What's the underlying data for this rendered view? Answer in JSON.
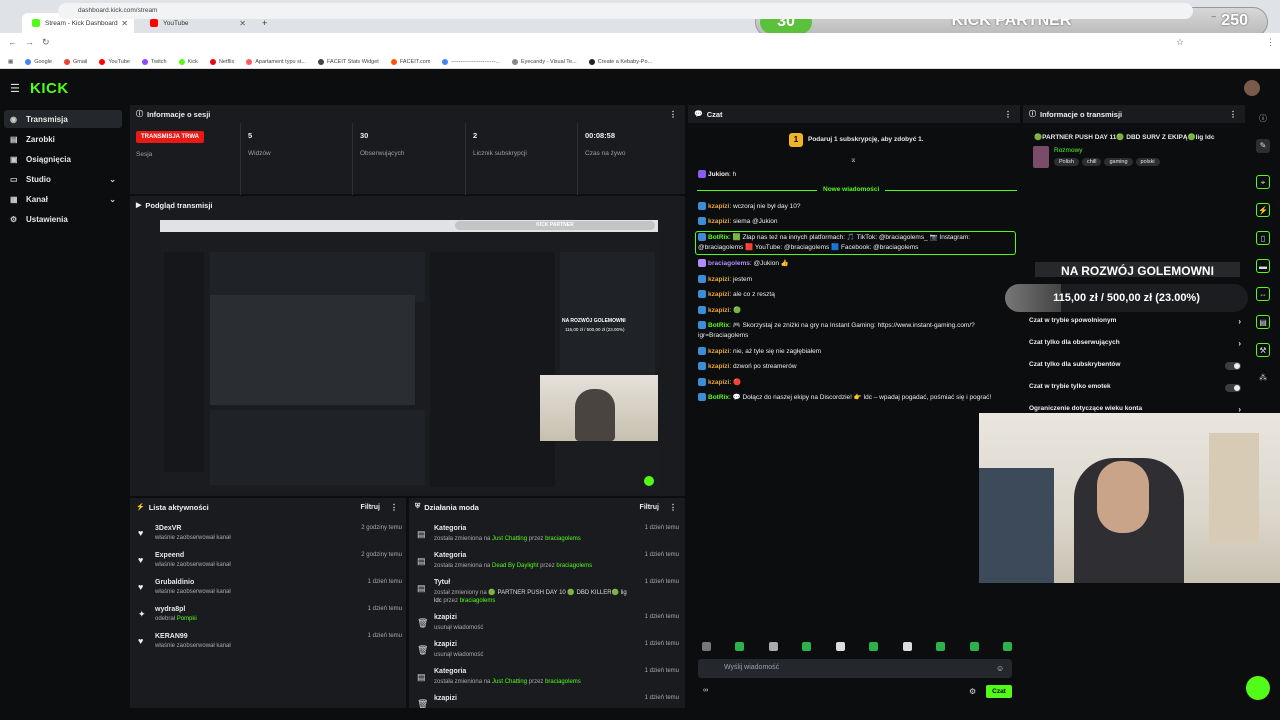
{
  "browser": {
    "tabs": [
      {
        "label": "Stream - Kick Dashboard",
        "active": true
      },
      {
        "label": "YouTube",
        "active": false
      }
    ],
    "new_tab": "+",
    "url": "dashboard.kick.com/stream",
    "bookmarks": [
      "Google",
      "Gmail",
      "YouTube",
      "Twitch",
      "Kick",
      "Netflix",
      "Apartament typu st...",
      "FACEIT Stats Widget",
      "FACEIT.com",
      "------------------------...",
      "Eyecandy - Visual Te...",
      "Create a Kebaby-Po..."
    ]
  },
  "overlay": {
    "level": "30",
    "title": "KICK PARTNER",
    "score": "250",
    "sep": "–"
  },
  "app": {
    "logo": "KICK"
  },
  "sidebar": {
    "items": [
      {
        "label": "Transmisja",
        "icon": "broadcast-icon"
      },
      {
        "label": "Zarobki",
        "icon": "wallet-icon"
      },
      {
        "label": "Osiągnięcia",
        "icon": "trophy-icon"
      },
      {
        "label": "Studio",
        "icon": "studio-icon"
      },
      {
        "label": "Kanał",
        "icon": "channel-icon"
      },
      {
        "label": "Ustawienia",
        "icon": "gear-icon"
      }
    ]
  },
  "session": {
    "title": "Informacje o sesji",
    "live_badge": "TRANSMISJA TRWA",
    "session_label": "Sesja",
    "stats": [
      {
        "value": "5",
        "label": "Widzów"
      },
      {
        "value": "30",
        "label": "Obserwujących"
      },
      {
        "value": "2",
        "label": "Licznik subskrypcji"
      },
      {
        "value": "00:08:58",
        "label": "Czas na żywo"
      }
    ]
  },
  "preview": {
    "title": "Podgląd transmisji",
    "inner_title": "KICK PARTNER",
    "inner_goal": "NA ROZWÓJ GOLEMOWNI",
    "inner_goal_sub": "115,00 zł / 500,00 zł (23.00%)"
  },
  "activity": {
    "title": "Lista aktywności",
    "filter": "Filtruj",
    "items": [
      {
        "name": "3DexVR",
        "sub": "właśnie zaobserwował kanał",
        "time": "2 godziny temu"
      },
      {
        "name": "Expeend",
        "sub": "właśnie zaobserwował kanał",
        "time": "2 godziny temu"
      },
      {
        "name": "Grubaldinio",
        "sub": "właśnie zaobserwował kanał",
        "time": "1 dzień temu"
      },
      {
        "name": "wydra8pl",
        "sub": "odebrał",
        "highlight": "Pompki",
        "time": "1 dzień temu"
      },
      {
        "name": "KERAN99",
        "sub": "właśnie zaobserwował kanał",
        "time": "1 dzień temu"
      }
    ]
  },
  "mod": {
    "title": "Działania moda",
    "filter": "Filtruj",
    "items": [
      {
        "name": "Kategoria",
        "pre": "została zmieniona na",
        "hl1": "Just Chatting",
        "mid": "przez",
        "hl2": "braciagolems",
        "time": "1 dzień temu"
      },
      {
        "name": "Kategoria",
        "pre": "została zmieniona na",
        "hl1": "Dead By Daylight",
        "mid": "przez",
        "hl2": "braciagolems",
        "time": "1 dzień temu"
      },
      {
        "name": "Tytuł",
        "pre": "został zmieniony na",
        "hl1": "🟢 PARTNER PUSH DAY 10 🟢 DBD KILLER🟢 lig ldc",
        "mid": "przez",
        "hl2": "braciagolems",
        "time": "1 dzień temu"
      },
      {
        "name": "kzapizi",
        "pre": "usunął wiadomość",
        "hl1": "",
        "mid": "",
        "hl2": "",
        "time": "1 dzień temu"
      },
      {
        "name": "kzapizi",
        "pre": "usunął wiadomość",
        "hl1": "",
        "mid": "",
        "hl2": "",
        "time": "1 dzień temu"
      },
      {
        "name": "Kategoria",
        "pre": "została zmieniona na",
        "hl1": "Just Chatting",
        "mid": "przez",
        "hl2": "braciagolems",
        "time": "1 dzień temu"
      },
      {
        "name": "kzapizi",
        "pre": "",
        "hl1": "",
        "mid": "",
        "hl2": "",
        "time": "1 dzień temu"
      }
    ]
  },
  "chat": {
    "title": "Czat",
    "sub_prompt": "Podaruj 1 subskrypcję, aby zdobyć 1.",
    "new_messages": "Nowe wiadomości",
    "messages": [
      {
        "user": "Jukion",
        "color": "#e5a83b",
        "text": "h"
      },
      {
        "user": "kzapizi",
        "color": "#e5a83b",
        "text": "wczoraj nie był day 10?"
      },
      {
        "user": "kzapizi",
        "color": "#e5a83b",
        "text": "siema @Jukion"
      },
      {
        "user": "BotRix",
        "color": "#53fc18",
        "text": "🟩 Złap nas też na innych platformach: 🎵 TikTok: @braciagolems_ 📷 Instagram: @braciagolems 🟥 YouTube: @braciagolems 🟦 Facebook: @braciagolems"
      },
      {
        "user": "braciagolems",
        "color": "#b58cff",
        "text": "@Jukion 👍"
      },
      {
        "user": "kzapizi",
        "color": "#e5a83b",
        "text": "jestem"
      },
      {
        "user": "kzapizi",
        "color": "#e5a83b",
        "text": "ale co z resztą"
      },
      {
        "user": "kzapizi",
        "color": "#e5a83b",
        "text": "🟢"
      },
      {
        "user": "BotRix",
        "color": "#53fc18",
        "text": "🎮 Skorzystaj ze zniżki na gry na Instant Gaming: https://www.instant-gaming.com/?igr=Braciagolems"
      },
      {
        "user": "kzapizi",
        "color": "#e5a83b",
        "text": "nie, aż tyle się nie zagłębiałem"
      },
      {
        "user": "kzapizi",
        "color": "#e5a83b",
        "text": "dzwoń po streamerów"
      },
      {
        "user": "kzapizi",
        "color": "#e5a83b",
        "text": "🔴"
      },
      {
        "user": "BotRix",
        "color": "#53fc18",
        "text": "💬 Dołącz do naszej ekipy na Discordzie! 👉 ldc – wpadaj pogadać, pośmiać się i pograć!"
      }
    ],
    "input_placeholder": "Wyślij wiadomość",
    "send": "Czat",
    "bottom_left": "∞"
  },
  "stream_info": {
    "title": "Informacje o transmisji",
    "stream_title": "🟢PARTNER PUSH DAY 11🟢 DBD SURV Z EKIPĄ🟢lig ldc",
    "category": "Rozmowy",
    "tags": [
      "Polish",
      "chill",
      "gaming",
      "polski"
    ],
    "goal_title": "NA ROZWÓJ GOLEMOWNI",
    "goal_progress": "115,00 zł / 500,00 zł (23.00%)",
    "goal_fraction": 0.23,
    "settings": [
      {
        "label": "Czat w trybie spowolnionym",
        "type": "chevron"
      },
      {
        "label": "Czat tylko dla obserwujących",
        "type": "chevron"
      },
      {
        "label": "Czat tylko dla subskrybentów",
        "type": "toggle"
      },
      {
        "label": "Czat w trybie tylko emotek",
        "type": "toggle"
      },
      {
        "label": "Ograniczenie dotyczące wieku konta",
        "type": "chevron"
      }
    ]
  },
  "colors": {
    "accent": "#53fc18",
    "live": "#e91916"
  }
}
